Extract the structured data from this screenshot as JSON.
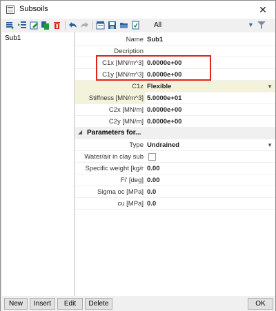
{
  "window": {
    "title": "Subsoils",
    "close_glyph": "✕"
  },
  "toolbar": {
    "filter_value": "All",
    "icons": [
      "new-row-icon",
      "insert-row-icon",
      "edit-icon",
      "copy-icon",
      "delete-icon",
      "undo-icon",
      "redo-icon",
      "table-icon",
      "save-icon",
      "folder-icon",
      "document-icon"
    ]
  },
  "list": {
    "items": [
      "Sub1"
    ]
  },
  "properties": {
    "name": {
      "label": "Name",
      "value": "Sub1"
    },
    "description": {
      "label": "Decription",
      "value": ""
    },
    "c1x": {
      "label": "C1x [MN/m^3]",
      "value": "0.0000e+00"
    },
    "c1y": {
      "label": "C1y [MN/m^3]",
      "value": "0.0000e+00"
    },
    "c1z": {
      "label": "C1z",
      "value": "Flexible"
    },
    "stiffness": {
      "label": "Stiffness [MN/m^3]",
      "value": "5.0000e+01"
    },
    "c2x": {
      "label": "C2x [MN/m]",
      "value": "0.0000e+00"
    },
    "c2y": {
      "label": "C2y [MN/m]",
      "value": "0.0000e+00"
    }
  },
  "parameters": {
    "section_title": "Parameters for...",
    "type": {
      "label": "Type",
      "value": "Undrained"
    },
    "water_air": {
      "label": "Water/air in clay sub",
      "checked": false
    },
    "specific_weight": {
      "label": "Specific weight [kg/r",
      "value": "0.00"
    },
    "fi": {
      "label": "Fi' [deg]",
      "value": "0.00"
    },
    "sigma_oc": {
      "label": "Sigma oc [MPa]",
      "value": "0.0"
    },
    "cu": {
      "label": "cu [MPa]",
      "value": "0.0"
    }
  },
  "buttons": {
    "new": "New",
    "insert": "Insert",
    "edit": "Edit",
    "delete": "Delete",
    "ok": "OK"
  },
  "colors": {
    "highlight_box": "#e0241b",
    "selected_row": "#f3f3dc",
    "accent": "#3a78c3"
  }
}
